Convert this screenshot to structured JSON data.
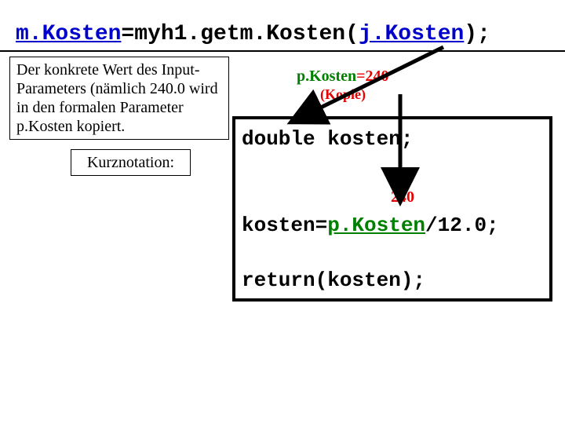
{
  "title": {
    "lhs": "m.Kosten",
    "eq": "=myh1.getm.Kosten(",
    "arg": "j.Kosten",
    "close": ");"
  },
  "explain": {
    "text": "Der konkrete Wert des Input-Parameters (nämlich 240.0 wird in den formalen Parameter p.Kosten kopiert."
  },
  "kurz": {
    "label": "Kurznotation:"
  },
  "annot": {
    "pKosten_lbl": "p.Kosten",
    "pKosten_val": "=240",
    "kopie": "(Kopie)",
    "val240": "240"
  },
  "code": {
    "line1": "double kosten;",
    "line2_a": "kosten=",
    "line2_b": "p.Kosten",
    "line2_c": "/12.0;",
    "line3": "return(kosten);"
  }
}
